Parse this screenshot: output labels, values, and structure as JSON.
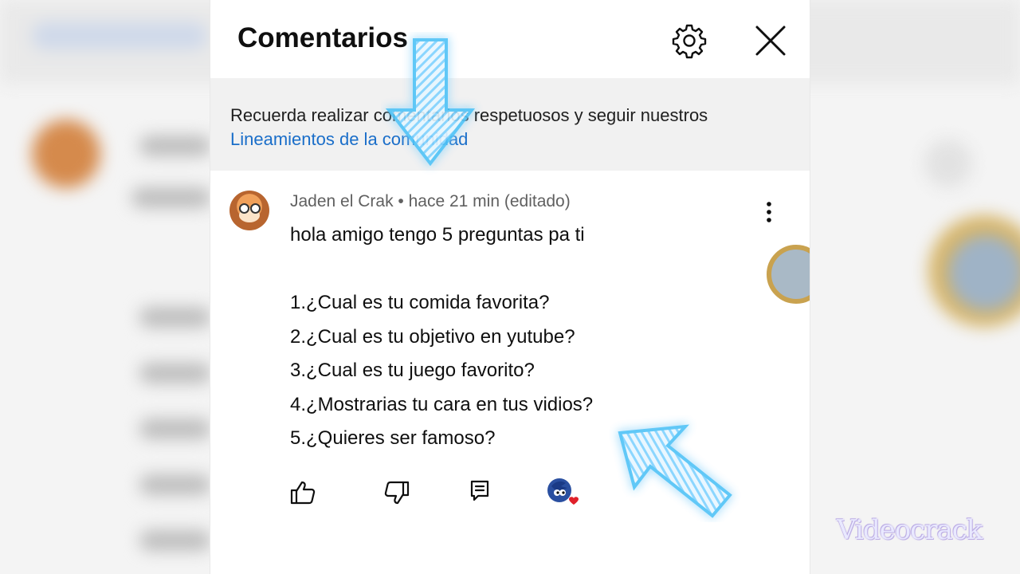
{
  "panel": {
    "title": "Comentarios",
    "notice_text": "Recuerda realizar comentarios respetuosos y seguir nuestros",
    "notice_link": "Lineamientos de la comunidad"
  },
  "comment": {
    "author": "Jaden el Crak",
    "separator": " • ",
    "time": "hace 21 min (editado)",
    "lines": [
      "hola amigo tengo 5 preguntas pa ti",
      "",
      "1.¿Cual es tu comida favorita?",
      "2.¿Cual es tu objetivo en yutube?",
      "3.¿Cual es tu juego favorito?",
      "4.¿Mostrarias tu cara en tus vidios?",
      "5.¿Quieres ser famoso?"
    ]
  },
  "icons": {
    "settings": "gear-icon",
    "close": "close-icon",
    "more": "more-vertical-icon",
    "like": "thumb-up-icon",
    "dislike": "thumb-down-icon",
    "reply": "reply-icon",
    "creator_heart": "creator-heart-icon"
  },
  "colors": {
    "link": "#1a6ec9",
    "notice_bg": "#f1f1f1",
    "arrow_glow": "#4fc3f7",
    "heart": "#e0202a"
  },
  "watermark": "Videocrack"
}
